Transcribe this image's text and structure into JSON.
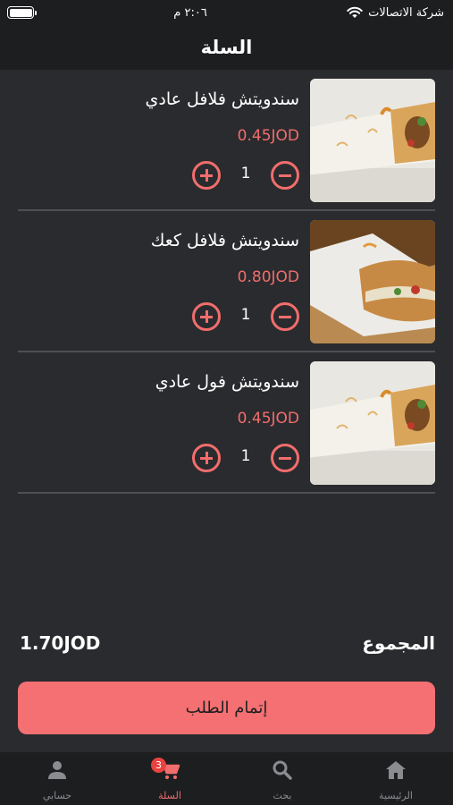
{
  "status_bar": {
    "carrier": "شركة الاتصالات",
    "time": "٢:٠٦ م",
    "icons": [
      "wifi-icon",
      "battery-icon"
    ]
  },
  "header": {
    "title": "السلة"
  },
  "cart": {
    "items": [
      {
        "name": "سندويتش فلافل عادي",
        "price": "0.45JOD",
        "quantity": "1"
      },
      {
        "name": "سندويتش فلافل كعك",
        "price": "0.80JOD",
        "quantity": "1"
      },
      {
        "name": "سندويتش فول عادي",
        "price": "0.45JOD",
        "quantity": "1"
      }
    ]
  },
  "summary": {
    "total_label": "المجموع",
    "total_value": "1.70JOD"
  },
  "checkout": {
    "label": "إتمام الطلب"
  },
  "tabbar": {
    "tabs": [
      {
        "label": "الرئيسية",
        "icon": "home-icon"
      },
      {
        "label": "بحث",
        "icon": "search-icon"
      },
      {
        "label": "السلة",
        "icon": "cart-icon",
        "badge": "3",
        "active": true
      },
      {
        "label": "حسابي",
        "icon": "user-icon"
      }
    ]
  },
  "colors": {
    "background": "#2a2b2e",
    "bar": "#1d1e20",
    "accent": "#f26d6d",
    "button": "#f57072",
    "badge": "#e9423f",
    "divider": "#4e4f53"
  }
}
